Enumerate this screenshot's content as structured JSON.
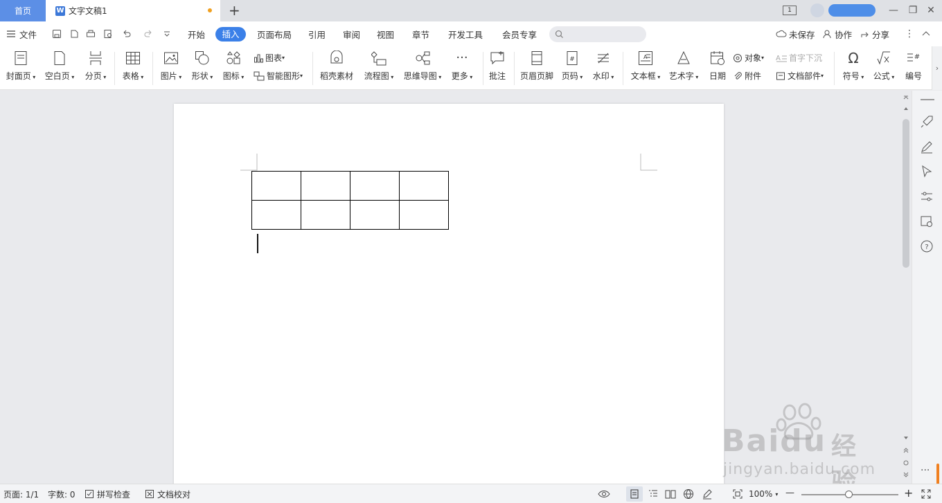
{
  "tabs": {
    "home": "首页",
    "document": "文字文稿1",
    "new_tab": "+",
    "page_badge": "1"
  },
  "window_controls": {
    "minimize": "—",
    "restore": "❐",
    "close": "✕"
  },
  "menu": {
    "file": "文件",
    "items": [
      "开始",
      "插入",
      "页面布局",
      "引用",
      "审阅",
      "视图",
      "章节",
      "开发工具",
      "会员专享"
    ],
    "active": "插入",
    "search_placeholder": "",
    "unsaved": "未保存",
    "collaborate": "协作",
    "share": "分享"
  },
  "ribbon": {
    "cover": "封面页",
    "blank": "空白页",
    "page_break": "分页",
    "table": "表格",
    "picture": "图片",
    "shape": "形状",
    "icon": "图标",
    "chart": "图表",
    "smartart": "智能图形",
    "material": "稻壳素材",
    "flowchart": "流程图",
    "mindmap": "思维导图",
    "more": "更多",
    "comment": "批注",
    "header_footer": "页眉页脚",
    "page_number": "页码",
    "watermark": "水印",
    "textbox": "文本框",
    "wordart": "艺术字",
    "date": "日期",
    "object": "对象",
    "attachment": "附件",
    "dropcap": "首字下沉",
    "doc_parts": "文档部件",
    "symbol": "符号",
    "formula": "公式",
    "numbering": "编号"
  },
  "document": {
    "table_rows": 2,
    "table_cols": 4
  },
  "status": {
    "page": "页面: 1/1",
    "words": "字数: 0",
    "spell": "拼写检查",
    "proof": "文档校对",
    "zoom": "100%",
    "zoom_minus": "—",
    "zoom_plus": "+"
  },
  "watermark": {
    "brand": "Baidu",
    "brand_cn": "经验",
    "url": "jingyan.baidu.com"
  },
  "colors": {
    "accent": "#3b80e8",
    "home_tab": "#5c8fe6",
    "modified_dot": "#f0a020"
  }
}
